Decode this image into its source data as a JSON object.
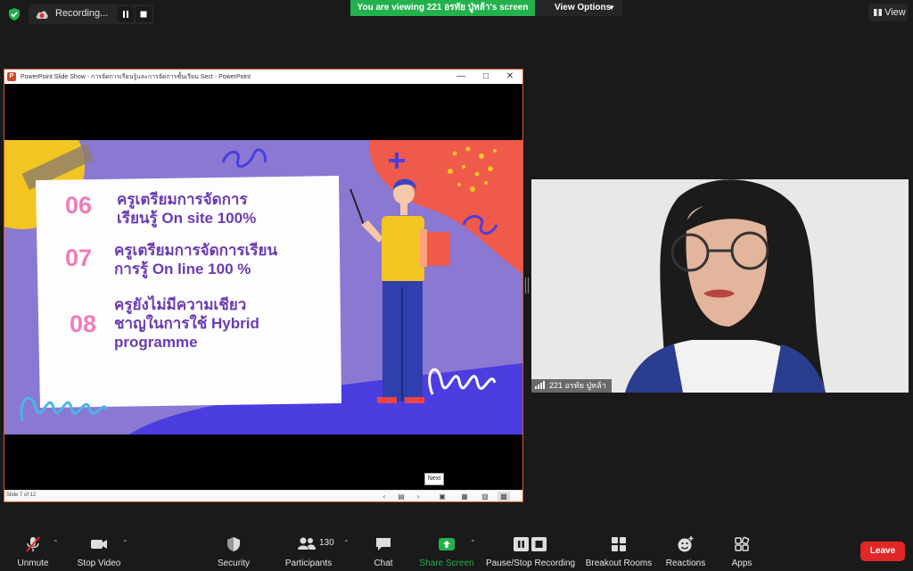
{
  "top_bar": {
    "recording_label": "Recording...",
    "viewing_banner": "You are viewing 221 อรทัย ปู่หล้า's screen",
    "view_options_label": "View Options",
    "view_label": "View"
  },
  "ppt": {
    "window_title": "PowerPoint Slide Show  -  การจัดการเรียนรู้และการจัดการชั้นเรียน Sect - PowerPoint",
    "slide_counter": "Slide 7 of 12",
    "next_tooltip": "Next",
    "slide": {
      "items": [
        {
          "num": "06",
          "line1": "ครูเตรียมการจัดการ",
          "line2": "เรียนรู้ On site 100%",
          "line3": ""
        },
        {
          "num": "07",
          "line1": "ครูเตรียมการจัดการเรียน",
          "line2": "การรู้ On line 100 %",
          "line3": ""
        },
        {
          "num": "08",
          "line1": "ครูยังไม่มีความเชียว",
          "line2": "ชาญในการใช้ Hybrid",
          "line3": "programme"
        }
      ]
    }
  },
  "video": {
    "participant_name": "221 อรทัย ปู่หล้า"
  },
  "toolbar": {
    "unmute": "Unmute",
    "stop_video": "Stop Video",
    "security": "Security",
    "participants": "Participants",
    "participants_count": "130",
    "chat": "Chat",
    "share_screen": "Share Screen",
    "pause_stop_recording": "Pause/Stop Recording",
    "breakout_rooms": "Breakout Rooms",
    "reactions": "Reactions",
    "apps": "Apps",
    "leave": "Leave"
  },
  "colors": {
    "accent_green": "#23b14d",
    "leave_red": "#e02828",
    "slide_purple": "#8b78d2",
    "slide_number_pink": "#f17cba",
    "slide_text_purple": "#6b3bb2"
  }
}
